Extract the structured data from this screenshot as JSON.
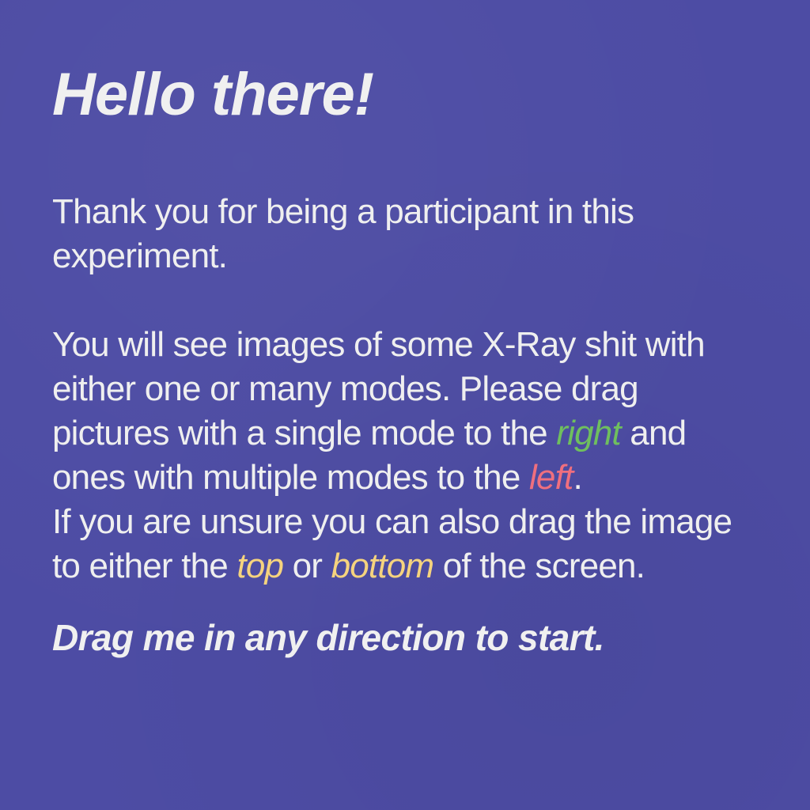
{
  "colors": {
    "background": "#4d4ca4",
    "text": "#efefef",
    "right": "#6fbf5e",
    "left": "#ef6f7e",
    "unsure": "#f5d37e"
  },
  "card": {
    "title": "Hello there!",
    "intro": "Thank you for being a participant in this experiment.",
    "instructions": {
      "part1": "You will see images of some X-Ray shit with either one or many modes. Please drag pictures with a single mode to the ",
      "right_word": "right",
      "part2": " and ones with multiple modes to the ",
      "left_word": "left",
      "part3": ".",
      "part4": "If you are unsure you can also drag the image to either the ",
      "top_word": "top",
      "part5": " or ",
      "bottom_word": "bottom",
      "part6": " of the screen."
    },
    "cta": "Drag me in any direction to start."
  }
}
